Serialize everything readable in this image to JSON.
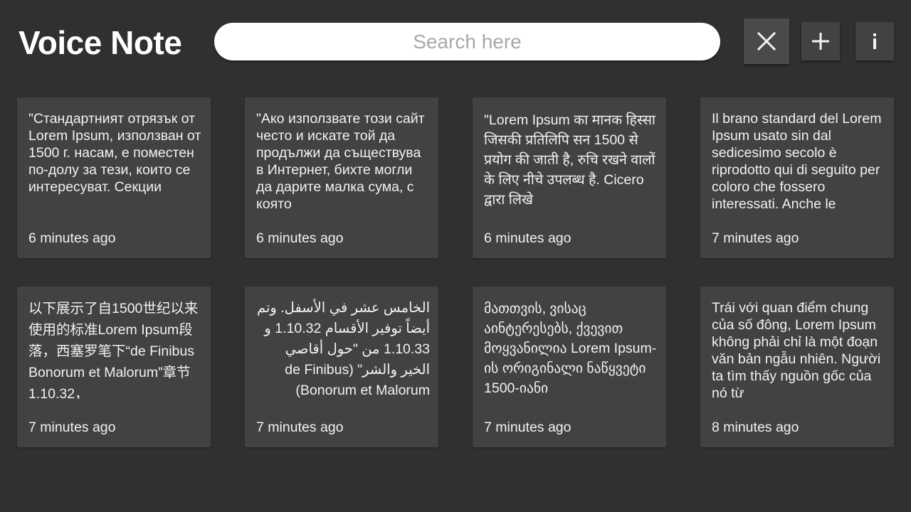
{
  "app": {
    "title": "Voice Note"
  },
  "search": {
    "placeholder": "Search here",
    "value": ""
  },
  "toolbar": {
    "close_icon": "close-icon",
    "add_icon": "plus-icon",
    "info_icon": "info-icon"
  },
  "colors": {
    "background": "#303030",
    "card": "#424242",
    "text": "#f2f2f2"
  },
  "notes": [
    {
      "text": "\"Стандартният отрязък от Lorem Ipsum, използван от 1500 г. насам, е поместен по-долу за тези, които се интересуват. Секции",
      "time": "6 minutes ago"
    },
    {
      "text": "\"Ако използвате този сайт често и искате той да продължи да съществува в Интернет, бихте могли да дарите малка сума, с която",
      "time": "6 minutes ago"
    },
    {
      "text": "\"Lorem Ipsum का मानक हिस्सा जिसकी प्रतिलिपि सन 1500 से प्रयोग की जाती है, रुचि रखने वालों के लिए नीचे उपलब्ध है. Cicero द्वारा लिखे",
      "time": "6 minutes ago"
    },
    {
      "text": "Il brano standard del Lorem Ipsum usato sin dal sedicesimo secolo è riprodotto qui di seguito per coloro che fossero interessati. Anche le",
      "time": "7 minutes ago"
    },
    {
      "text": "以下展示了自1500世纪以来使用的标准Lorem Ipsum段落，西塞罗笔下“de Finibus Bonorum et Malorum”章节1.10.32，",
      "time": "7 minutes ago"
    },
    {
      "text": "الخامس عشر في الأسفل. وتم أيضاً توفير الأقسام 1.10.32 و 1.10.33 من \"حول أقاصي الخير والشر\" (de Finibus Bonorum et Malorum) لمؤلفه شيشيرون",
      "time": "7 minutes ago"
    },
    {
      "text": "მათთვის, ვისაც აინტერესებს, ქვევით მოყვანილია Lorem Ipsum-ის ორიგინალი ნაწყვეტი 1500-იანი",
      "time": "7 minutes ago"
    },
    {
      "text": "Trái với quan điểm chung của số đông, Lorem Ipsum không phải chỉ là một đoạn văn bản ngẫu nhiên. Người ta tìm thấy nguồn gốc của nó từ",
      "time": "8 minutes ago"
    }
  ]
}
